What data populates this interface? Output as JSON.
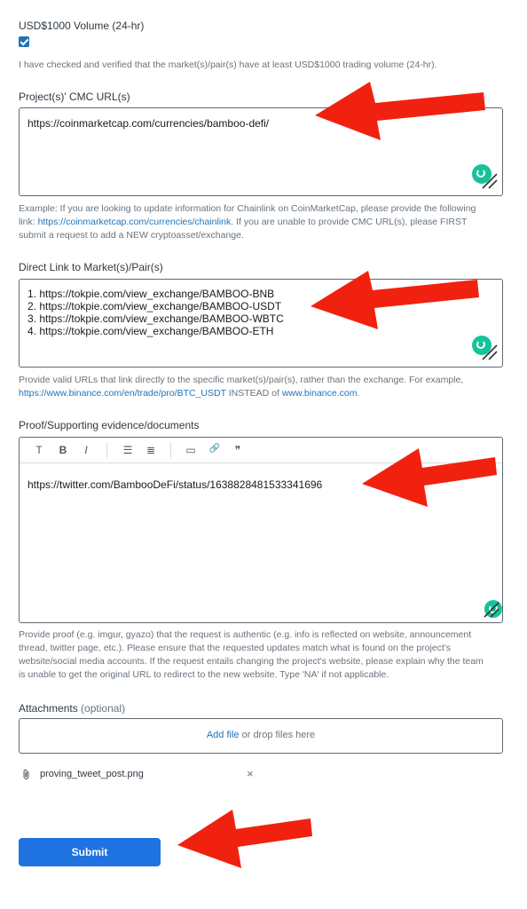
{
  "volume": {
    "label": "USD$1000 Volume (24-hr)",
    "checked": true,
    "confirm_text": "I have checked and verified that the market(s)/pair(s) have at least USD$1000 trading volume (24-hr)."
  },
  "cmc": {
    "label": "Project(s)' CMC URL(s)",
    "value": "https://coinmarketcap.com/currencies/bamboo-defi/",
    "hint_pre": "Example: If you are looking to update information for Chainlink on CoinMarketCap, please provide the following",
    "hint_link_prefix": "link: ",
    "hint_link": "https://coinmarketcap.com/currencies/chainlink",
    "hint_post": ". If you are unable to provide CMC URL(s), please FIRST",
    "hint_line3": "submit a request to add a NEW cryptoasset/exchange."
  },
  "market": {
    "label": "Direct Link to Market(s)/Pair(s)",
    "lines": [
      "1. https://tokpie.com/view_exchange/BAMBOO-BNB",
      "2. https://tokpie.com/view_exchange/BAMBOO-USDT",
      "3. https://tokpie.com/view_exchange/BAMBOO-WBTC",
      "4. https://tokpie.com/view_exchange/BAMBOO-ETH"
    ],
    "hint_line1": "Provide valid URLs that link directly to the specific market(s)/pair(s), rather than the exchange. For example,",
    "hint_link1": "https://www.binance.com/en/trade/pro/BTC_USDT",
    "hint_mid": " INSTEAD of ",
    "hint_link2": "www.binance.com",
    "hint_end": "."
  },
  "proof": {
    "label": "Proof/Supporting evidence/documents",
    "value": "https://twitter.com/BambooDeFi/status/1638828481533341696",
    "toolbar": {
      "text": "T",
      "bold": "B",
      "italic": "I",
      "bullet": "☰",
      "numbered": "≣",
      "code": "▭",
      "link": "🔗",
      "quote": "❞"
    },
    "hint_lines": [
      "Provide proof (e.g. imgur, gyazo) that the request is authentic (e.g. info is reflected on website, announcement",
      "thread, twitter page, etc.). Please ensure that the requested updates match what is found on the project's",
      "website/social media accounts. If the request entails changing the project's website, please explain why the team",
      "is unable to get the original URL to redirect to the new website. Type 'NA' if not applicable."
    ]
  },
  "attachments": {
    "label": "Attachments",
    "optional": "(optional)",
    "add_file": "Add file",
    "drop_text": " or drop files here",
    "file_name": "proving_tweet_post.png",
    "remove": "×"
  },
  "submit_label": "Submit",
  "colors": {
    "accent": "#1f73b7",
    "submit": "#1f73e0",
    "arrow": "#f0220f",
    "grammarly": "#15c39a"
  }
}
